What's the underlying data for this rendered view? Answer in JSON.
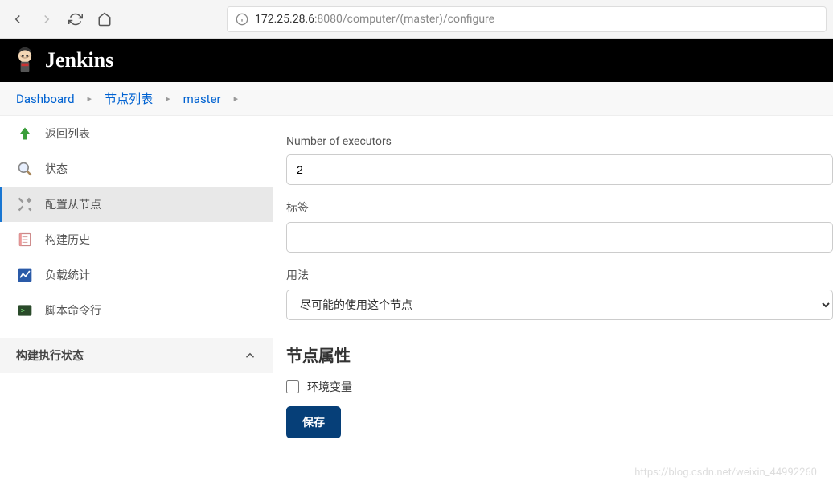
{
  "browser": {
    "url_host": "172.25.28.6",
    "url_path": ":8080/computer/(master)/configure"
  },
  "header": {
    "brand": "Jenkins"
  },
  "breadcrumbs": {
    "items": [
      "Dashboard",
      "节点列表",
      "master"
    ]
  },
  "sidebar": {
    "items": [
      {
        "label": "返回列表",
        "icon": "up-arrow"
      },
      {
        "label": "状态",
        "icon": "magnifier"
      },
      {
        "label": "配置从节点",
        "icon": "wrench",
        "active": true
      },
      {
        "label": "构建历史",
        "icon": "notepad"
      },
      {
        "label": "负载统计",
        "icon": "chart"
      },
      {
        "label": "脚本命令行",
        "icon": "terminal"
      }
    ],
    "section": {
      "label": "构建执行状态"
    }
  },
  "form": {
    "executors": {
      "label": "Number of executors",
      "value": "2"
    },
    "labels": {
      "label": "标签",
      "value": ""
    },
    "usage": {
      "label": "用法",
      "selected": "尽可能的使用这个节点"
    },
    "properties_title": "节点属性",
    "env_vars": {
      "label": "环境变量",
      "checked": false
    },
    "save_label": "保存"
  },
  "watermark": "https://blog.csdn.net/weixin_44992260"
}
